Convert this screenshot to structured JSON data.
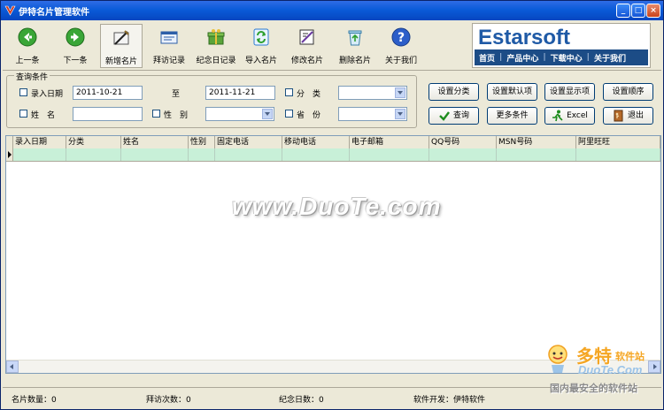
{
  "window": {
    "title": "伊特名片管理软件"
  },
  "toolbar": {
    "prev": "上一条",
    "next": "下一条",
    "new_card": "新增名片",
    "visit_log": "拜访记录",
    "memorial_log": "纪念日记录",
    "import_card": "导入名片",
    "edit_card": "修改名片",
    "delete_card": "删除名片",
    "about": "关于我们"
  },
  "brand": {
    "logo": "Estarsoft",
    "nav": [
      "首页",
      "产品中心",
      "下载中心",
      "关于我们"
    ]
  },
  "query": {
    "legend": "查询条件",
    "entry_date_label": "录入日期",
    "date_from": "2011-10-21",
    "to_label": "至",
    "date_to": "2011-11-21",
    "category_label": "分　类",
    "name_label": "姓　名",
    "gender_label": "性　别",
    "province_label": "省　份",
    "name_value": ""
  },
  "buttons": {
    "set_category": "设置分类",
    "set_default": "设置默认项",
    "set_display": "设置显示项",
    "set_order": "设置顺序",
    "search": "查询",
    "more_conditions": "更多条件",
    "excel": "Excel",
    "exit": "退出"
  },
  "grid": {
    "columns": [
      "录入日期",
      "分类",
      "姓名",
      "性别",
      "固定电话",
      "移动电话",
      "电子邮箱",
      "QQ号码",
      "MSN号码",
      "阿里旺旺"
    ],
    "watermark": "www.DuoTe.com"
  },
  "status": {
    "card_count": "名片数量：0",
    "visit_count": "拜访次数：0",
    "memorial_count": "纪念日数：0",
    "developer": "软件开发：伊特软件"
  },
  "corner_watermark": {
    "name": "多特",
    "suffix": "软件站",
    "site": "DuoTe.Com",
    "slogan": "国内最安全的软件站"
  }
}
